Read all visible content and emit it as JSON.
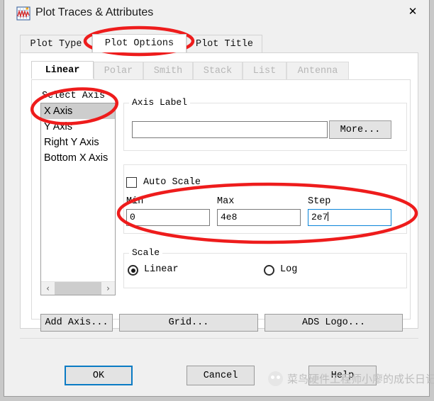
{
  "window": {
    "title": "Plot Traces & Attributes",
    "icon": "plot-graph-icon",
    "close_label": "✕"
  },
  "outer_tabs": [
    {
      "label": "Plot Type",
      "selected": false
    },
    {
      "label": "Plot Options",
      "selected": true
    },
    {
      "label": "Plot Title",
      "selected": false
    }
  ],
  "inner_tabs": [
    {
      "label": "Linear",
      "selected": true,
      "enabled": true
    },
    {
      "label": "Polar",
      "selected": false,
      "enabled": false
    },
    {
      "label": "Smith",
      "selected": false,
      "enabled": false
    },
    {
      "label": "Stack",
      "selected": false,
      "enabled": false
    },
    {
      "label": "List",
      "selected": false,
      "enabled": false
    },
    {
      "label": "Antenna",
      "selected": false,
      "enabled": false
    }
  ],
  "select_axis": {
    "label": "Select Axis",
    "items": [
      {
        "label": "X Axis",
        "selected": true
      },
      {
        "label": "Y Axis",
        "selected": false
      },
      {
        "label": "Right Y Axis",
        "selected": false
      },
      {
        "label": "Bottom X Axis",
        "selected": false
      }
    ],
    "scrollbar": {
      "left_arrow": "‹",
      "right_arrow": "›"
    }
  },
  "axis_label": {
    "group_label": "Axis Label",
    "value": "",
    "placeholder": "",
    "more_button": "More..."
  },
  "scale_range": {
    "auto_scale_label": "Auto Scale",
    "auto_scale_checked": false,
    "min_label": "Min",
    "min_value": "0",
    "max_label": "Max",
    "max_value": "4e8",
    "step_label": "Step",
    "step_value": "2e7",
    "step_focused": true
  },
  "scale": {
    "group_label": "Scale",
    "options": [
      {
        "label": "Linear",
        "selected": true
      },
      {
        "label": "Log",
        "selected": false
      }
    ]
  },
  "action_buttons": [
    {
      "label": "Add Axis..."
    },
    {
      "label": "Grid..."
    },
    {
      "label": "ADS Logo..."
    }
  ],
  "dialog_buttons": [
    {
      "label": "OK",
      "default": true
    },
    {
      "label": "Cancel",
      "default": false
    },
    {
      "label": "Help",
      "default": false
    }
  ],
  "watermark": {
    "text": "菜鸟硬件工程师小廖的成长日记"
  },
  "annotations": {
    "color": "#ee1c1c",
    "ellipses": [
      {
        "name": "plot-options-tab-highlight"
      },
      {
        "name": "x-axis-item-highlight"
      },
      {
        "name": "min-max-step-highlight"
      }
    ]
  }
}
